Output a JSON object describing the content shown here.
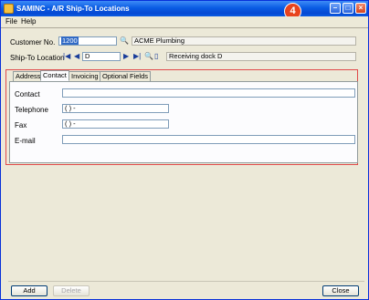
{
  "window": {
    "title": "SAMINC - A/R Ship-To Locations",
    "step_badge": "4"
  },
  "title_buttons": {
    "minimize": "–",
    "maximize": "□",
    "close": "×"
  },
  "menu": {
    "file": "File",
    "help": "Help"
  },
  "header": {
    "customer_label": "Customer No.",
    "customer_value": "1200",
    "customer_name": "ACME Plumbing",
    "shipto_label": "Ship-To Location",
    "shipto_value": "D",
    "shipto_description": "Receiving dock D"
  },
  "icons": {
    "finder": "🔍",
    "first": "|◀",
    "prev": "◀",
    "next": "▶",
    "last": "▶|",
    "new": "▯"
  },
  "tabs": [
    {
      "label": "Address",
      "active": false
    },
    {
      "label": "Contact",
      "active": true
    },
    {
      "label": "Invoicing",
      "active": false
    },
    {
      "label": "Optional Fields",
      "active": false
    }
  ],
  "contact_form": {
    "contact_label": "Contact",
    "contact_value": "",
    "telephone_label": "Telephone",
    "telephone_value": "(    )    -",
    "fax_label": "Fax",
    "fax_value": "(    )    -",
    "email_label": "E-mail",
    "email_value": ""
  },
  "buttons": {
    "add": "Add",
    "delete": "Delete",
    "close": "Close"
  },
  "colors": {
    "titlebar": "#0a5ce3",
    "badge": "#e8441e",
    "highlight_frame": "#e04b4b"
  }
}
